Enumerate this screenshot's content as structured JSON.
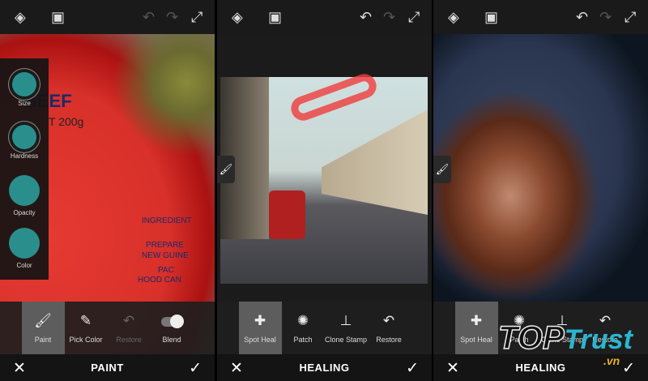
{
  "panels": [
    {
      "mode": "PAINT",
      "tools": [
        {
          "label": "Paint",
          "icon": "brush-icon",
          "selected": true
        },
        {
          "label": "Pick Color",
          "icon": "eyedropper-icon"
        },
        {
          "label": "Restore",
          "icon": "restore-icon",
          "disabled": true
        },
        {
          "label": "Blend",
          "icon": "toggle-icon"
        }
      ],
      "sidebar": [
        {
          "label": "Size"
        },
        {
          "label": "Hardness"
        },
        {
          "label": "Opacity"
        },
        {
          "label": "Color"
        }
      ],
      "swatch_color": "#2a8f8c",
      "photo_text": [
        "BEEF",
        "T 200g",
        "INGREDIENT",
        "PREPARE",
        "NEW GUINE",
        "PAC",
        "HOOD CAN"
      ]
    },
    {
      "mode": "HEALING",
      "tools": [
        {
          "label": "Spot Heal",
          "icon": "bandage-icon",
          "selected": true
        },
        {
          "label": "Patch",
          "icon": "patch-icon"
        },
        {
          "label": "Clone Stamp",
          "icon": "stamp-icon"
        },
        {
          "label": "Restore",
          "icon": "restore-icon"
        }
      ]
    },
    {
      "mode": "HEALING",
      "tools": [
        {
          "label": "Spot Heal",
          "icon": "bandage-icon",
          "selected": true
        },
        {
          "label": "Patch",
          "icon": "patch-icon"
        },
        {
          "label": "Clone Stamp",
          "icon": "stamp-icon"
        },
        {
          "label": "Restore",
          "icon": "restore-icon"
        }
      ]
    }
  ],
  "watermark": {
    "top": "TOP",
    "trust": "Trust",
    ".vn": ".vn"
  },
  "icons": {
    "layers": "◈",
    "compare": "▣",
    "undo": "↶",
    "redo": "↷",
    "expand": "⤢",
    "close": "✕",
    "check": "✓",
    "brush": "🖌"
  }
}
